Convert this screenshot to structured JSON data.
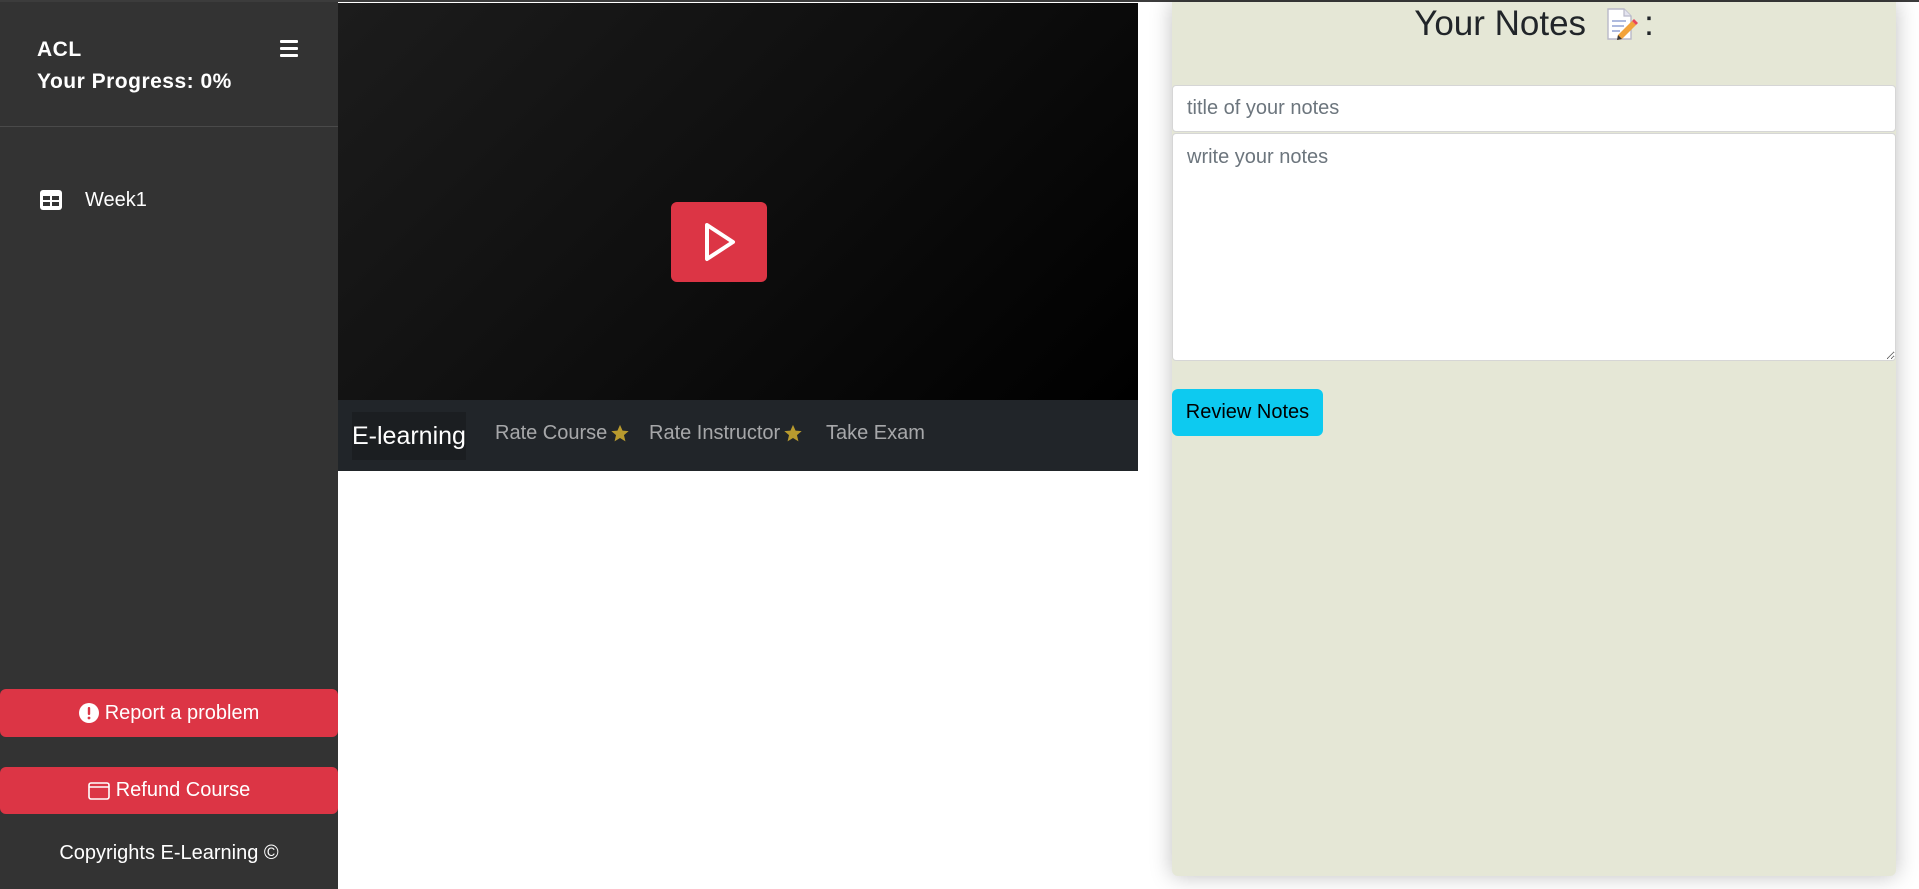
{
  "sidebar": {
    "course_name": "ACL",
    "progress_label": "Your Progress: 0%",
    "menu_icon": "hamburger-icon",
    "items": [
      {
        "label": "Week1",
        "icon": "table-icon"
      }
    ],
    "report_button": {
      "label": "Report a problem",
      "icon": "exclamation-circle-icon"
    },
    "refund_button": {
      "label": "Refund Course",
      "icon": "window-icon"
    },
    "copyright": "Copyrights E-Learning ©"
  },
  "video": {
    "play_icon": "play-icon"
  },
  "navbar": {
    "brand": "E-learning",
    "items": [
      {
        "label": "Rate Course",
        "icon": "star-icon"
      },
      {
        "label": "Rate Instructor",
        "icon": "star-icon"
      },
      {
        "label": "Take Exam"
      }
    ]
  },
  "notes": {
    "title": "Your Notes",
    "title_suffix": ":",
    "title_icon": "memo-icon",
    "title_placeholder": "title of your notes",
    "body_placeholder": "write your notes",
    "review_button": "Review Notes"
  },
  "colors": {
    "sidebar_bg": "#333333",
    "danger": "#dc3545",
    "navbar_bg": "#212529",
    "notes_bg": "#e5e7d6",
    "info": "#0dcaf0",
    "star": "#b89a2e"
  }
}
